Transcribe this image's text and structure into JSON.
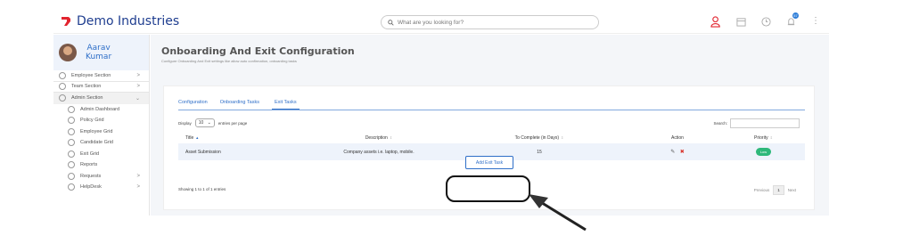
{
  "app": {
    "brand": "Demo Industries"
  },
  "search": {
    "placeholder": "What are you looking for?"
  },
  "colors": {
    "brand_blue": "#1e3d8f",
    "link_blue": "#2f6fc8",
    "logo_red": "#e2242f",
    "priority_low": "#2eb87a",
    "delete_red": "#d9342b"
  },
  "header": {
    "icons": [
      "user-alert-icon",
      "calendar-icon",
      "clock-icon",
      "bell-icon",
      "kebab-menu-icon"
    ],
    "notification_count": "57"
  },
  "profile": {
    "first_name": "Aarav",
    "last_name": "Kumar"
  },
  "sidebar": {
    "items": [
      {
        "label": "Employee Section",
        "arrow": ">"
      },
      {
        "label": "Team Section",
        "arrow": ">"
      },
      {
        "label": "Admin Section",
        "arrow": "⌄"
      },
      {
        "label": "Admin Dashboard"
      },
      {
        "label": "Policy Grid"
      },
      {
        "label": "Employee Grid"
      },
      {
        "label": "Candidate Grid"
      },
      {
        "label": "Exit Grid"
      },
      {
        "label": "Reports"
      },
      {
        "label": "Requests",
        "arrow": ">"
      },
      {
        "label": "HelpDesk",
        "arrow": ">"
      }
    ]
  },
  "page": {
    "title": "Onboarding And Exit Configuration",
    "subtitle": "Configure Onboarding And Exit settings like allow auto confirmation, onboarding tasks"
  },
  "tabs": [
    {
      "label": "Configuration"
    },
    {
      "label": "Onboarding Tasks"
    },
    {
      "label": "Exit Tasks",
      "active": true
    }
  ],
  "table_controls": {
    "display_label": "Display",
    "display_value": "10",
    "entries_label": "entries per page",
    "search_label": "Search:"
  },
  "table": {
    "columns": [
      "Title",
      "Description",
      "To Complete (in Days)",
      "Action",
      "Priority"
    ],
    "rows": [
      {
        "title": "Asset Submission",
        "description": "Company assets i.e. laptop, mobile.",
        "days": "15",
        "priority": "Low"
      }
    ]
  },
  "footer": {
    "showing": "Showing 1 to 1 of 1 entries",
    "previous": "Previous",
    "page": "1",
    "next": "Next"
  },
  "add_button": "Add Exit Task"
}
